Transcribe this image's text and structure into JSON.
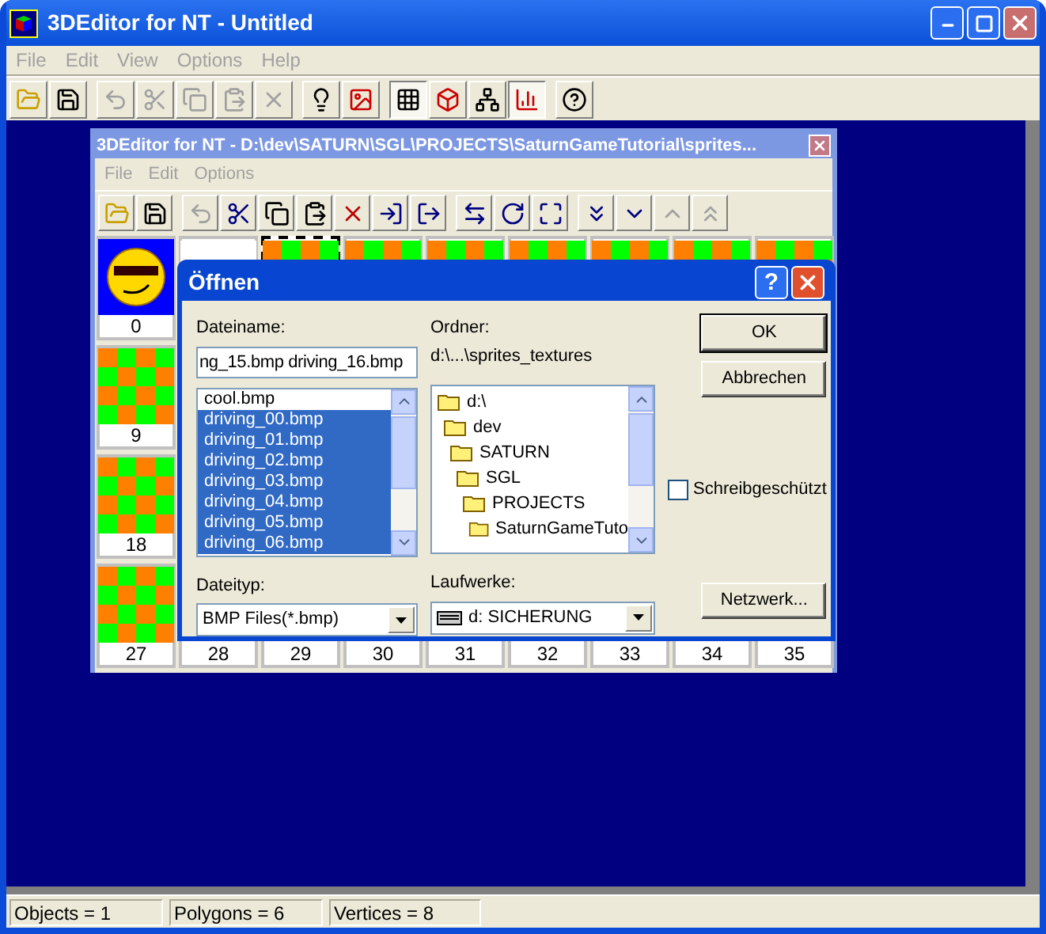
{
  "window": {
    "title": "3DEditor for NT - Untitled"
  },
  "menu": [
    "File",
    "Edit",
    "View",
    "Options",
    "Help"
  ],
  "toolbar": {
    "groups": [
      [
        {
          "disabled": false,
          "pressed": false
        },
        {
          "disabled": false,
          "pressed": false
        }
      ],
      [
        {
          "disabled": true,
          "pressed": false
        },
        {
          "disabled": true,
          "pressed": false
        },
        {
          "disabled": true,
          "pressed": false
        },
        {
          "disabled": true,
          "pressed": false
        },
        {
          "disabled": true,
          "pressed": false
        }
      ],
      [
        {
          "disabled": false,
          "pressed": false
        },
        {
          "disabled": false,
          "pressed": false
        }
      ],
      [
        {
          "disabled": false,
          "pressed": true
        },
        {
          "disabled": false,
          "pressed": false
        },
        {
          "disabled": false,
          "pressed": false
        },
        {
          "disabled": false,
          "pressed": true
        }
      ],
      [
        {
          "disabled": false,
          "pressed": false
        }
      ]
    ]
  },
  "child_window": {
    "title": "3DEditor for NT - D:\\dev\\SATURN\\SGL\\PROJECTS\\SaturnGameTutorial\\sprites...",
    "menu": [
      "File",
      "Edit",
      "Options"
    ],
    "toolbar": {
      "groups": [
        [
          {
            "disabled": false
          },
          {
            "disabled": false
          }
        ],
        [
          {
            "disabled": true
          },
          {
            "disabled": false
          },
          {
            "disabled": false
          },
          {
            "disabled": false
          },
          {
            "disabled": false
          },
          {
            "disabled": false
          },
          {
            "disabled": false
          }
        ],
        [
          {
            "disabled": false
          },
          {
            "disabled": false
          },
          {
            "disabled": false
          }
        ],
        [
          {
            "disabled": false
          },
          {
            "disabled": false
          },
          {
            "disabled": true
          },
          {
            "disabled": true
          }
        ]
      ]
    },
    "thumbnails": [
      [
        {
          "kind": "smiley",
          "label": "0",
          "selected": false
        },
        {
          "kind": "blank",
          "selected": false
        },
        {
          "kind": "checker",
          "selected": true
        },
        {
          "kind": "checker",
          "selected": false
        },
        {
          "kind": "checker",
          "selected": false
        },
        {
          "kind": "checker",
          "selected": false
        },
        {
          "kind": "checker",
          "selected": false
        },
        {
          "kind": "checker",
          "selected": false
        },
        {
          "kind": "checker",
          "selected": false
        }
      ],
      [
        {
          "kind": "checker",
          "label": "9",
          "selected": false
        }
      ],
      [
        {
          "kind": "checker",
          "label": "18",
          "selected": false
        }
      ],
      [
        {
          "kind": "checker",
          "label": "27",
          "selected": false
        },
        {
          "label": "28",
          "selected": false
        },
        {
          "label": "29",
          "selected": false
        },
        {
          "label": "30",
          "selected": false
        },
        {
          "label": "31",
          "selected": false
        },
        {
          "label": "32",
          "selected": false
        },
        {
          "label": "33",
          "selected": false
        },
        {
          "label": "34",
          "selected": false
        },
        {
          "label": "35",
          "selected": false
        }
      ]
    ]
  },
  "dialog": {
    "title": "Öffnen",
    "help": "?",
    "filename_label": "Dateiname:",
    "filename": "ng_15.bmp driving_16.bmp",
    "files": [
      {
        "name": "cool.bmp",
        "selected": false
      },
      {
        "name": "driving_00.bmp",
        "selected": true
      },
      {
        "name": "driving_01.bmp",
        "selected": true
      },
      {
        "name": "driving_02.bmp",
        "selected": true
      },
      {
        "name": "driving_03.bmp",
        "selected": true
      },
      {
        "name": "driving_04.bmp",
        "selected": true
      },
      {
        "name": "driving_05.bmp",
        "selected": true
      },
      {
        "name": "driving_06.bmp",
        "selected": true
      }
    ],
    "folder_label": "Ordner:",
    "folder_path": "d:\\...\\sprites_textures",
    "folders": [
      {
        "name": "d:\\",
        "children": [
          {
            "name": "dev",
            "children": [
              {
                "name": "SATURN",
                "children": [
                  {
                    "name": "SGL",
                    "children": [
                      {
                        "name": "PROJECTS",
                        "children": [
                          {
                            "name": "SaturnGameTuto"
                          }
                        ]
                      }
                    ]
                  }
                ]
              }
            ]
          }
        ]
      }
    ],
    "filetype_label": "Dateityp:",
    "filetype": "BMP Files(*.bmp)",
    "drives_label": "Laufwerke:",
    "drive": "d: SICHERUNG",
    "ok": "OK",
    "cancel": "Abbrechen",
    "network": "Netzwerk...",
    "readonly": {
      "label": "Schreibgeschützt",
      "checked": false
    }
  },
  "status_bar": [
    "Objects = 1",
    "Polygons = 6",
    "Vertices = 8"
  ]
}
